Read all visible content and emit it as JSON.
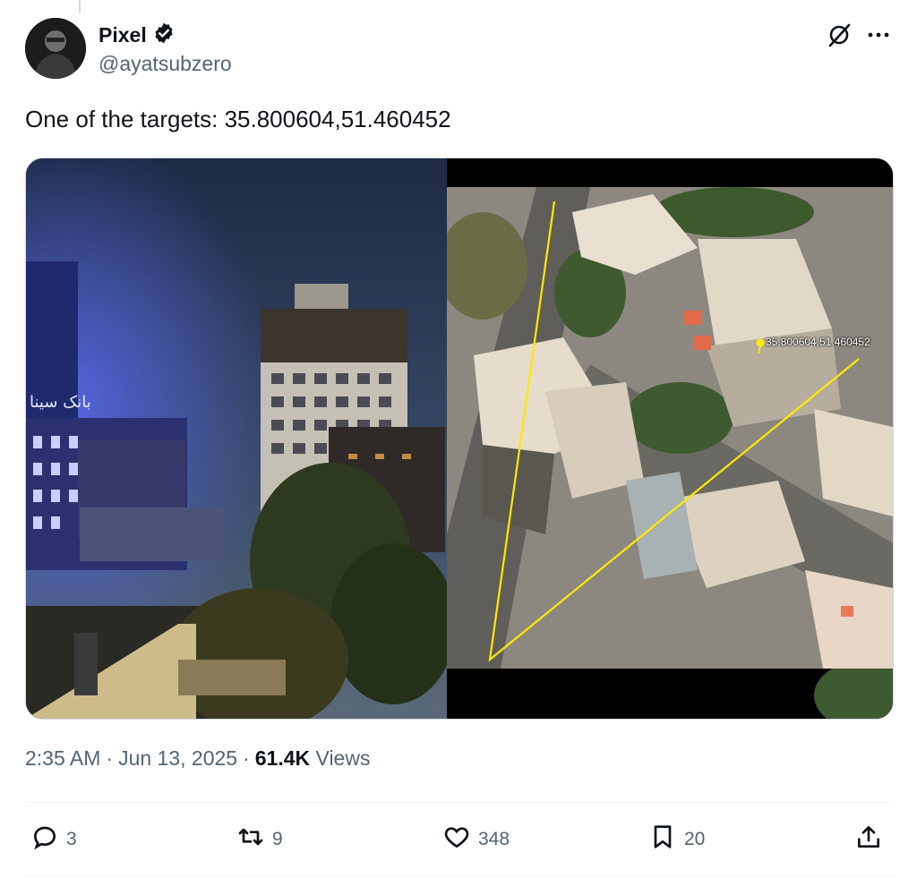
{
  "author": {
    "display_name": "Pixel",
    "handle": "@ayatsubzero",
    "verified": true
  },
  "post": {
    "text": "One of the targets: 35.800604,51.460452"
  },
  "media": {
    "map_label": "35.800604,51.460452",
    "sign_text": "بانک سینا"
  },
  "meta": {
    "time": "2:35 AM",
    "sep1": "·",
    "date": "Jun 13, 2025",
    "sep2": "·",
    "views_count": "61.4K",
    "views_label": "Views"
  },
  "actions": {
    "replies": "3",
    "reposts": "9",
    "likes": "348",
    "bookmarks": "20"
  },
  "icons": [
    "verified-badge-icon",
    "grok-icon",
    "more-icon",
    "reply-icon",
    "repost-icon",
    "like-icon",
    "bookmark-icon",
    "share-icon"
  ],
  "colors": {
    "text": "#0f1419",
    "secondary": "#536471",
    "accent": "#1d9bf0",
    "highlight": "#ffe800"
  }
}
